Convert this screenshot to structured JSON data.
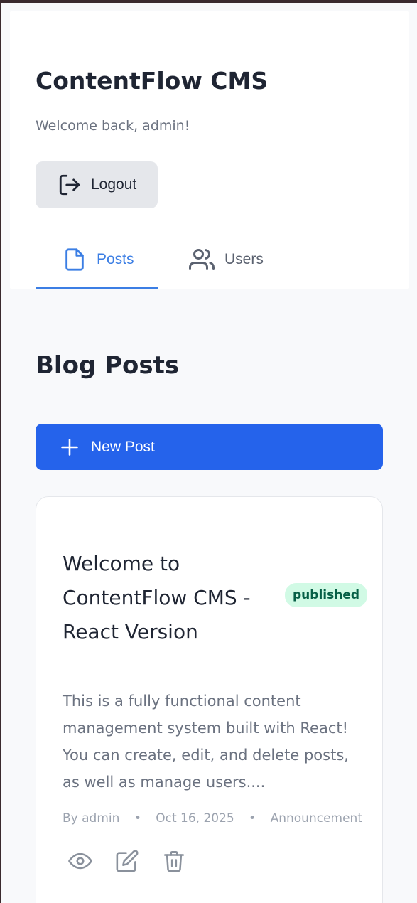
{
  "header": {
    "app_title": "ContentFlow CMS",
    "welcome_text": "Welcome back, admin!",
    "logout_label": "Logout",
    "logout_icon": "logout-icon"
  },
  "tabs": [
    {
      "label": "Posts",
      "icon": "document-icon",
      "active": true
    },
    {
      "label": "Users",
      "icon": "users-icon",
      "active": false
    }
  ],
  "main": {
    "section_title": "Blog Posts",
    "new_post_label": "New Post",
    "new_post_icon": "plus-icon"
  },
  "posts": [
    {
      "title": "Welcome to ContentFlow CMS - React Version",
      "status": "published",
      "excerpt": "This is a fully functional content management system built with React! You can create, edit, and delete posts, as well as manage users....",
      "author": "By admin",
      "date": "Oct 16, 2025",
      "category": "Announcement",
      "meta_separator": "•",
      "actions": [
        "eye-icon",
        "edit-icon",
        "trash-icon"
      ]
    }
  ],
  "colors": {
    "accent": "#2563eb",
    "tab_active": "#3b7ee4",
    "badge_bg": "#d1fae5",
    "badge_text": "#065f46"
  }
}
